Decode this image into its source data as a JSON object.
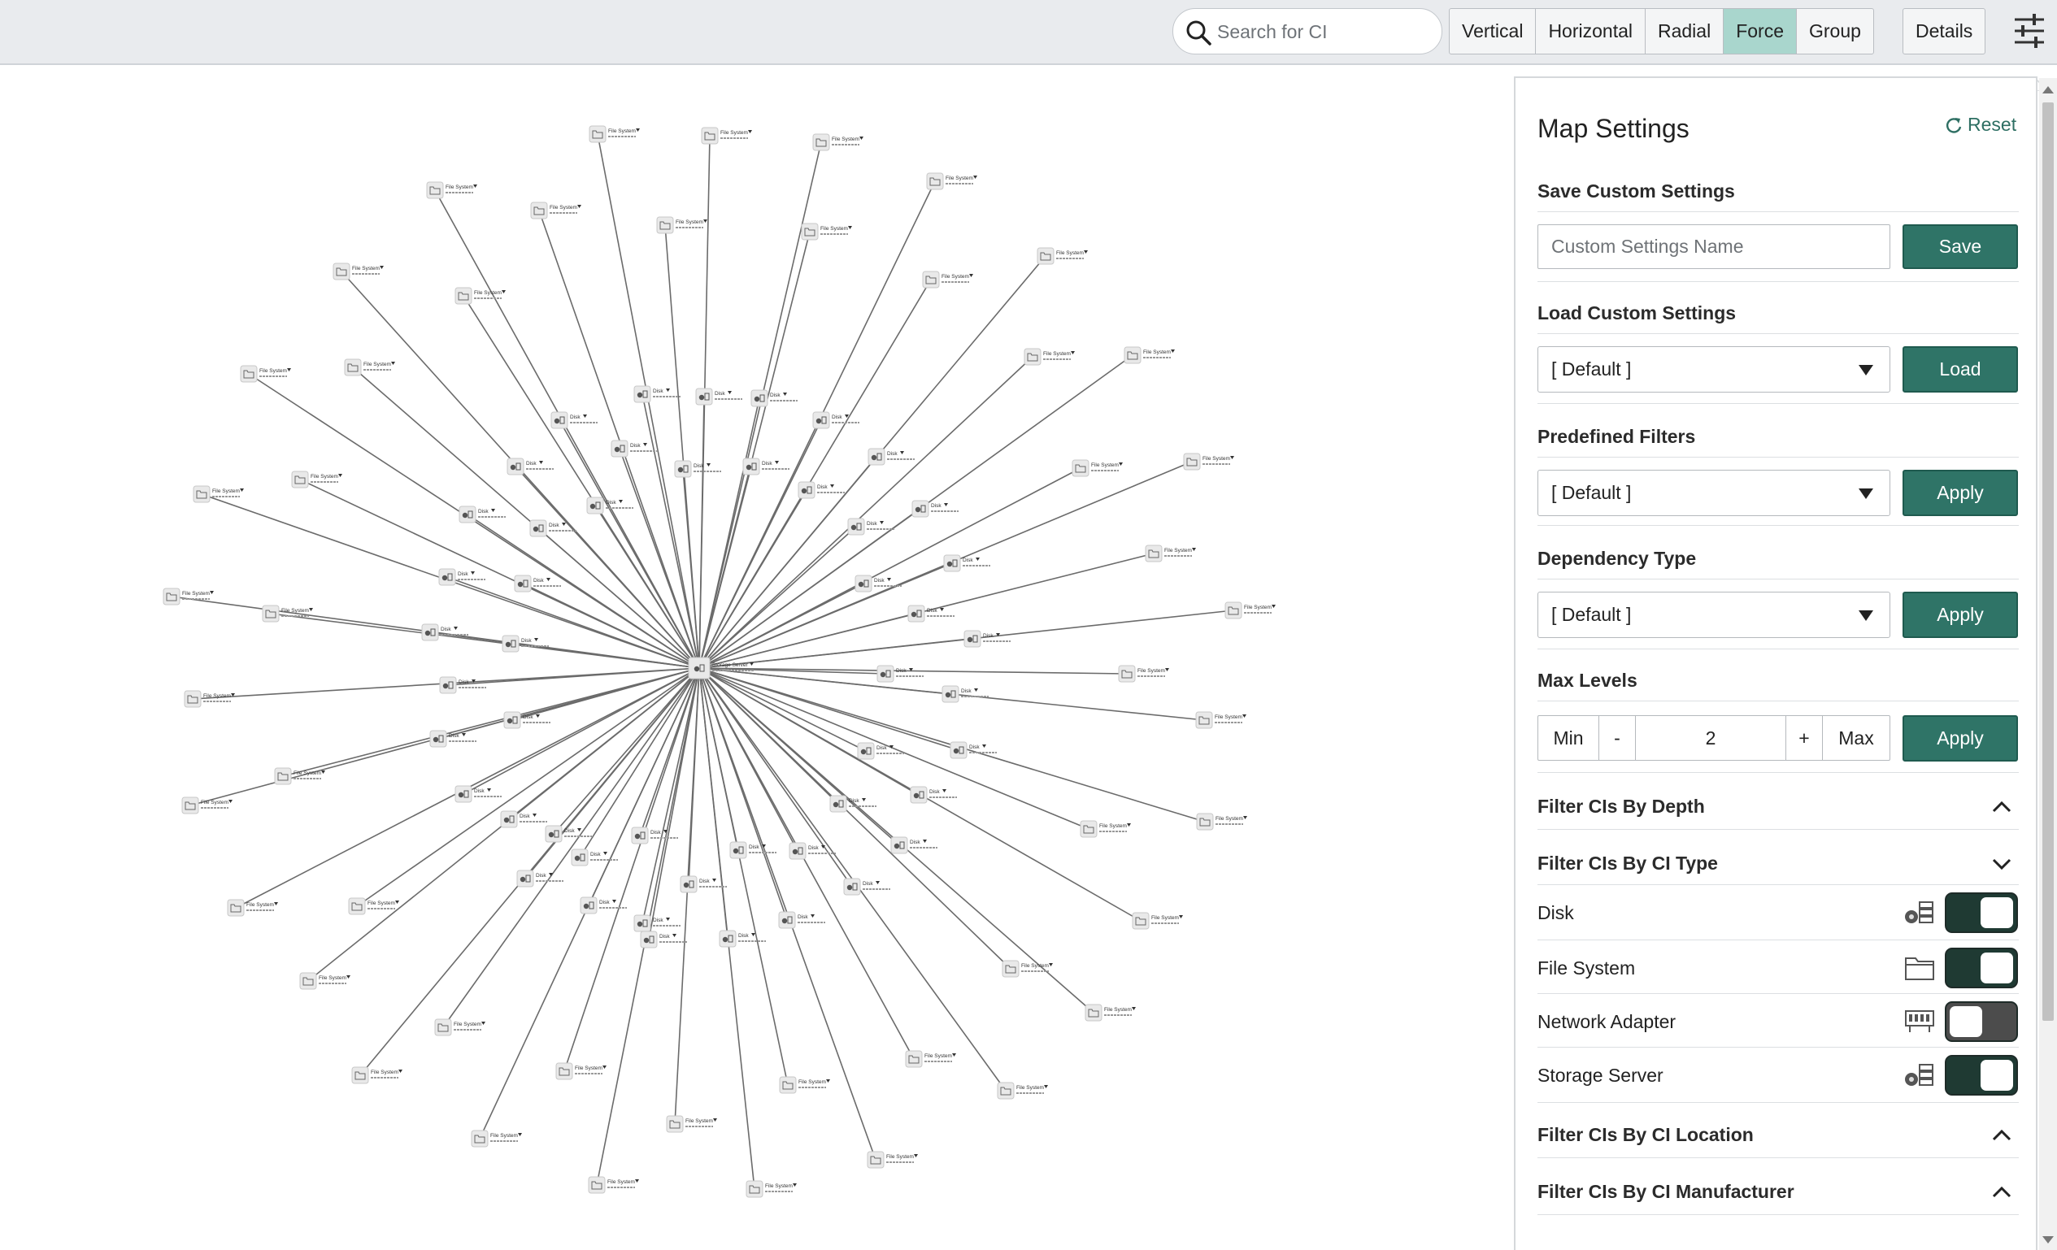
{
  "toolbar": {
    "search_placeholder": "Search for CI",
    "layouts": [
      {
        "label": "Vertical",
        "active": false
      },
      {
        "label": "Horizontal",
        "active": false
      },
      {
        "label": "Radial",
        "active": false
      },
      {
        "label": "Force",
        "active": true
      },
      {
        "label": "Group",
        "active": false
      }
    ],
    "details_label": "Details",
    "settings_icon": "sliders-icon",
    "active_color": "#a9d6cd"
  },
  "graph": {
    "center_node": {
      "name": "Storage Server",
      "icon": "storage-server-icon"
    },
    "node_label_fs": "File System",
    "node_label_disk": "Disk",
    "edge_color": "#6b6b6b"
  },
  "settings": {
    "title": "Map Settings",
    "reset_label": "Reset",
    "save_custom": {
      "label": "Save Custom Settings",
      "placeholder": "Custom Settings Name",
      "button": "Save"
    },
    "load_custom": {
      "label": "Load Custom Settings",
      "value": "[ Default ]",
      "button": "Load"
    },
    "predefined_filters": {
      "label": "Predefined Filters",
      "value": "[ Default ]",
      "button": "Apply"
    },
    "dependency_type": {
      "label": "Dependency Type",
      "value": "[ Default ]",
      "button": "Apply"
    },
    "max_levels": {
      "label": "Max Levels",
      "min": "Min",
      "minus": "-",
      "value": "2",
      "plus": "+",
      "max": "Max",
      "button": "Apply"
    },
    "filters": {
      "depth": "Filter CIs By Depth",
      "ci_type": "Filter CIs By CI Type",
      "location": "Filter CIs By CI Location",
      "manufacturer": "Filter CIs By CI Manufacturer"
    },
    "ci_types": [
      {
        "label": "Disk",
        "icon": "disk-icon",
        "enabled": true
      },
      {
        "label": "File System",
        "icon": "folder-icon",
        "enabled": true
      },
      {
        "label": "Network Adapter",
        "icon": "network-adapter-icon",
        "enabled": false
      },
      {
        "label": "Storage Server",
        "icon": "storage-server-icon",
        "enabled": true
      }
    ],
    "accent": "#2f7467"
  }
}
